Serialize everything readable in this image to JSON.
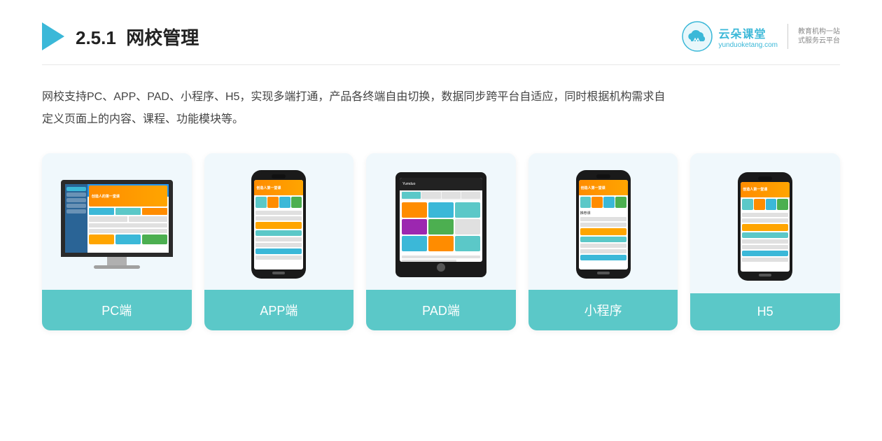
{
  "header": {
    "section_number": "2.5.1",
    "section_title": "网校管理",
    "brand_name": "云朵课堂",
    "brand_url": "yunduoketang.com",
    "brand_slogan_line1": "教育机构一站",
    "brand_slogan_line2": "式服务云平台"
  },
  "description": {
    "text": "网校支持PC、APP、PAD、小程序、H5，实现多端打通，产品各终端自由切换，数据同步跨平台自适应，同时根据机构需求自定义页面上的内容、课程、功能模块等。"
  },
  "cards": [
    {
      "id": "pc",
      "label": "PC端"
    },
    {
      "id": "app",
      "label": "APP端"
    },
    {
      "id": "pad",
      "label": "PAD端"
    },
    {
      "id": "miniprogram",
      "label": "小程序"
    },
    {
      "id": "h5",
      "label": "H5"
    }
  ]
}
